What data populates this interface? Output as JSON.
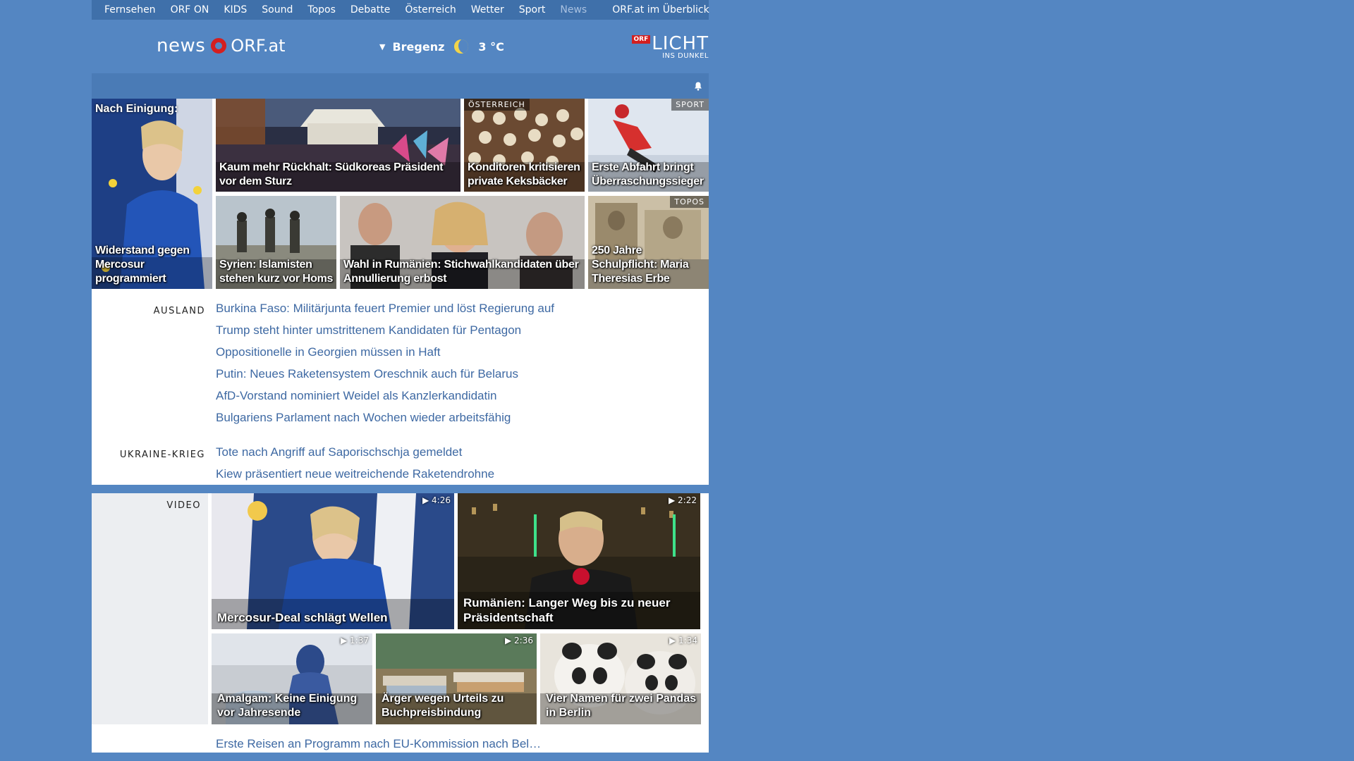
{
  "nav": {
    "items": [
      "Fernsehen",
      "ORF ON",
      "KIDS",
      "Sound",
      "Topos",
      "Debatte",
      "Österreich",
      "Wetter",
      "Sport",
      "News"
    ],
    "overview": "ORF.at im Überblick"
  },
  "header": {
    "logo_news": "news",
    "logo_orf": "ORF.at",
    "weather_location": "Bregenz",
    "weather_temp": "3 °C",
    "licht_badge": "ORF",
    "licht_big": "LICHT",
    "licht_small": "INS DUNKEL"
  },
  "tiles": [
    {
      "caption": "Widerstand gegen Mercosur programmiert",
      "top_label": "Nach Einigung:"
    },
    {
      "caption": "Kaum mehr Rückhalt: Südkoreas Präsident vor dem Sturz"
    },
    {
      "caption": "Konditoren kritisieren private Keksbäcker",
      "tag": "ÖSTERREICH"
    },
    {
      "caption": "Erste Abfahrt bringt Überraschungssieger",
      "tag": "SPORT"
    },
    {
      "caption": "Syrien: Islamisten stehen kurz vor Homs"
    },
    {
      "caption": "Wahl in Rumänien: Stichwahlkandidaten über Annullierung erbost"
    },
    {
      "caption": "250 Jahre Schulpflicht: Maria Theresias Erbe",
      "tag": "TOPOS"
    }
  ],
  "sections": [
    {
      "label": "AUSLAND",
      "items": [
        "Burkina Faso: Militärjunta feuert Premier und löst Regierung auf",
        "Trump steht hinter umstrittenem Kandidaten für Pentagon",
        "Oppositionelle in Georgien müssen in Haft",
        "Putin: Neues Raketensystem Oreschnik auch für Belarus",
        "AfD-Vorstand nominiert Weidel als Kanzlerkandidatin",
        "Bulgariens Parlament nach Wochen wieder arbeitsfähig"
      ]
    },
    {
      "label": "UKRAINE-KRIEG",
      "items": [
        "Tote nach Angriff auf Saporischschja gemeldet",
        "Kiew präsentiert neue weitreichende Raketendrohne"
      ]
    }
  ],
  "video": {
    "label": "VIDEO",
    "items": [
      {
        "title": "Mercosur-Deal schlägt Wellen",
        "duration": "4:26"
      },
      {
        "title": "Rumänien: Langer Weg bis zu neuer Präsidentschaft",
        "duration": "2:22"
      },
      {
        "title": "Amalgam: Keine Einigung vor Jahresende",
        "duration": "1:37"
      },
      {
        "title": "Ärger wegen Urteils zu Buchpreisbindung",
        "duration": "2:36"
      },
      {
        "title": "Vier Namen für zwei Pandas in Berlin",
        "duration": "1:34"
      }
    ]
  },
  "bottom_partial": "Erste Reisen an Programm nach EU-Kommission nach Bel…",
  "colors": {
    "page_bg": "#5486c2",
    "nav_bg": "#3f70aa",
    "link": "#3e69a3",
    "logo_ring": "#d41f1f"
  }
}
